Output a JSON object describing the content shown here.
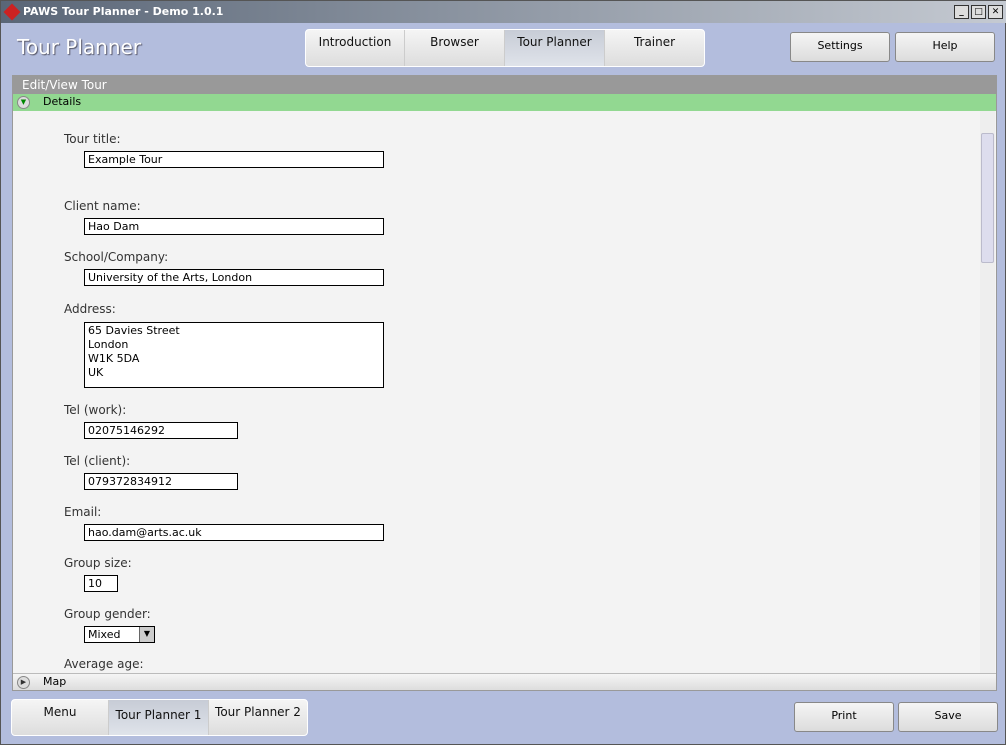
{
  "window": {
    "title": "PAWS Tour Planner - Demo 1.0.1"
  },
  "header": {
    "title": "Tour Planner",
    "tabs": [
      "Introduction",
      "Browser",
      "Tour Planner",
      "Trainer"
    ],
    "selected_tab": "Tour Planner",
    "settings": "Settings",
    "help": "Help"
  },
  "panel": {
    "title": "Edit/View Tour",
    "details": "Details",
    "map": "Map"
  },
  "form": {
    "tour_title_label": "Tour title:",
    "tour_title": "Example Tour",
    "client_label": "Client name:",
    "client": "Hao Dam",
    "school_label": "School/Company:",
    "school": "University of the Arts, London",
    "address_label": "Address:",
    "address": "65 Davies Street\nLondon\nW1K 5DA\nUK",
    "tel_work_label": "Tel (work):",
    "tel_work": "02075146292",
    "tel_client_label": "Tel (client):",
    "tel_client": "079372834912",
    "email_label": "Email:",
    "email": "hao.dam@arts.ac.uk",
    "group_size_label": "Group size:",
    "group_size": "10",
    "gender_label": "Group gender:",
    "gender": "Mixed",
    "age_label": "Average age:"
  },
  "footer": {
    "tabs": [
      "Menu",
      "Tour Planner 1",
      "Tour Planner 2"
    ],
    "selected_tab": "Tour Planner 1",
    "print": "Print",
    "save": "Save"
  }
}
